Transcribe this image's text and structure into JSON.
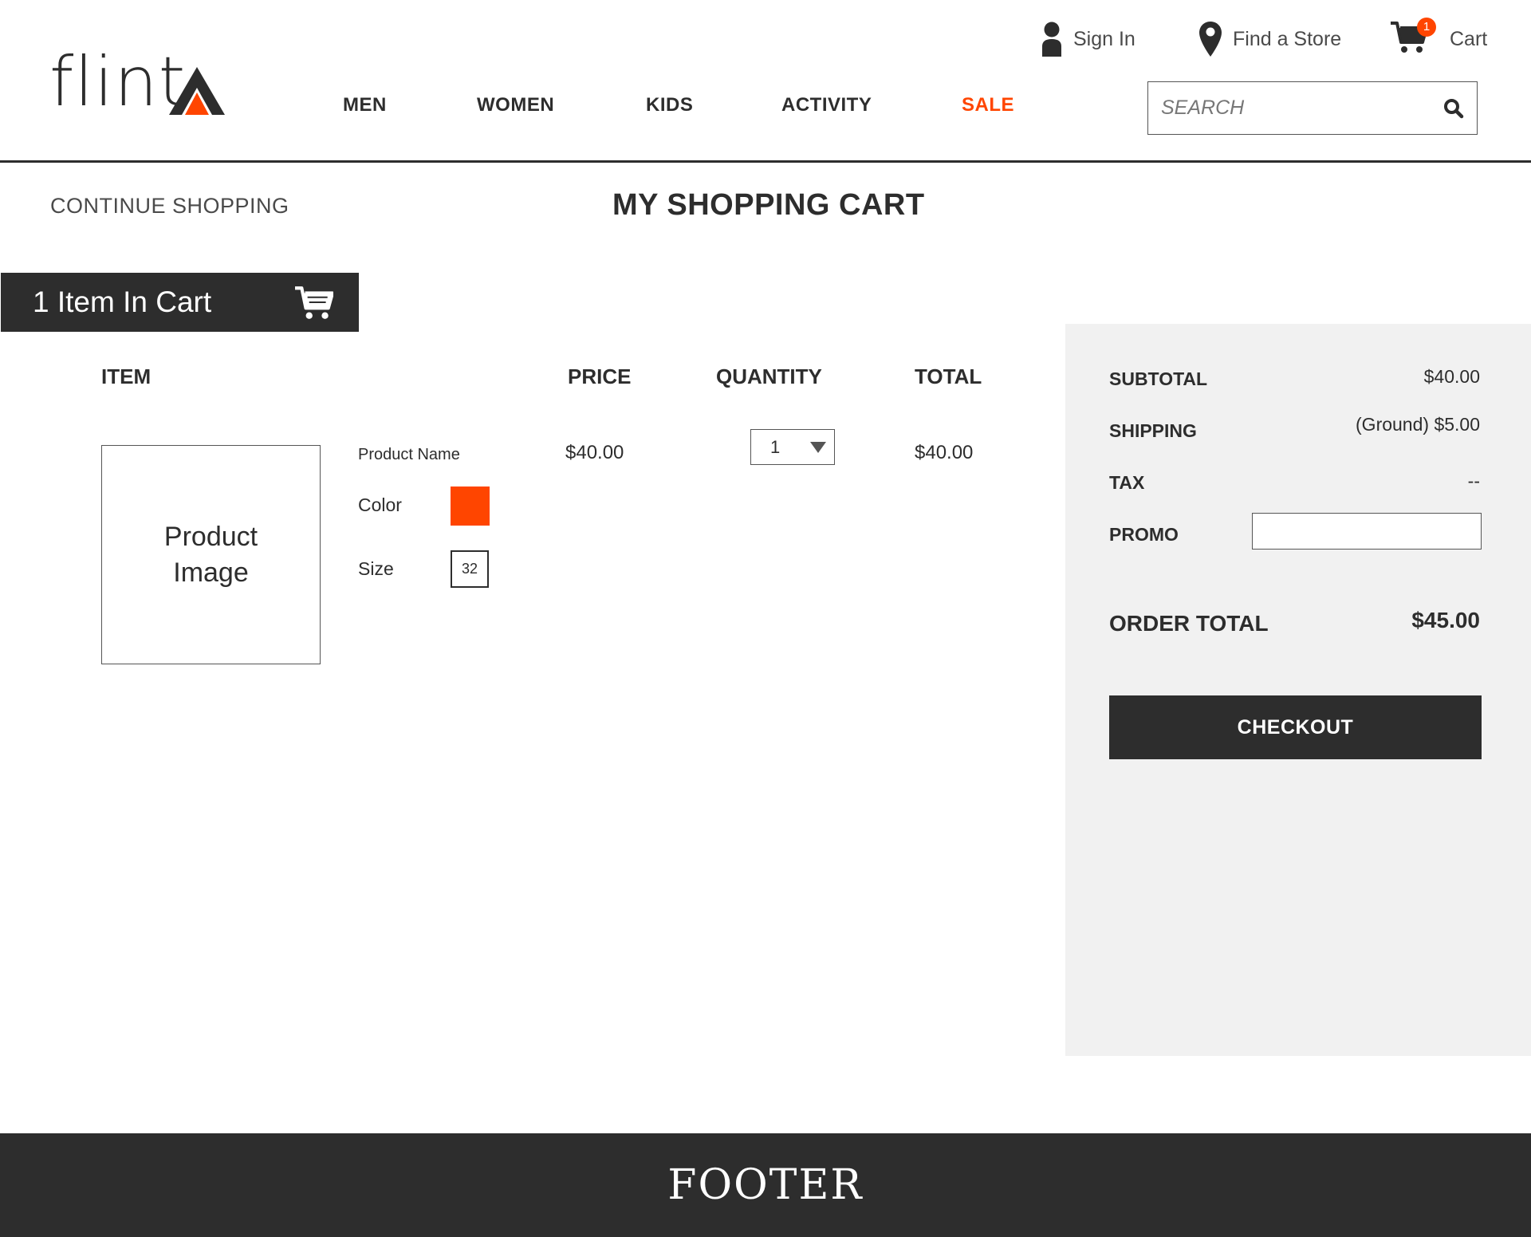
{
  "brand": {
    "logo_text": "flint",
    "accent_color": "#ff4500",
    "dark_color": "#2d2d2d"
  },
  "header": {
    "utility": {
      "sign_in": {
        "label": "Sign In",
        "icon": "user-icon"
      },
      "find_store": {
        "label": "Find a Store",
        "icon": "map-pin-icon"
      },
      "cart": {
        "label": "Cart",
        "icon": "cart-icon",
        "badge": "1"
      }
    },
    "nav": [
      {
        "label": "MEN"
      },
      {
        "label": "WOMEN"
      },
      {
        "label": "KIDS"
      },
      {
        "label": "ACTIVITY"
      },
      {
        "label": "SALE"
      }
    ],
    "search": {
      "placeholder": "SEARCH",
      "value": "",
      "icon": "search-icon"
    }
  },
  "page": {
    "continue_shopping": "CONTINUE SHOPPING",
    "title": "MY SHOPPING CART"
  },
  "cart_bar": {
    "label": "1 Item In Cart",
    "icon": "cart-icon"
  },
  "table": {
    "headers": {
      "item": "ITEM",
      "price": "PRICE",
      "quantity": "QUANTITY",
      "total": "TOTAL"
    },
    "rows": [
      {
        "image_line1": "Product",
        "image_line2": "Image",
        "name": "Product Name",
        "color_label": "Color",
        "color_value": "#ff4500",
        "size_label": "Size",
        "size_value": "32",
        "price": "$40.00",
        "quantity": "1",
        "total": "$40.00"
      }
    ]
  },
  "summary": {
    "subtotal_label": "SUBTOTAL",
    "subtotal_value": "$40.00",
    "shipping_label": "SHIPPING",
    "shipping_value": "(Ground) $5.00",
    "tax_label": "TAX",
    "tax_value": "--",
    "promo_label": "PROMO",
    "promo_value": "",
    "order_total_label": "ORDER TOTAL",
    "order_total_value": "$45.00",
    "checkout_label": "CHECKOUT"
  },
  "footer": {
    "label": "FOOTER"
  }
}
